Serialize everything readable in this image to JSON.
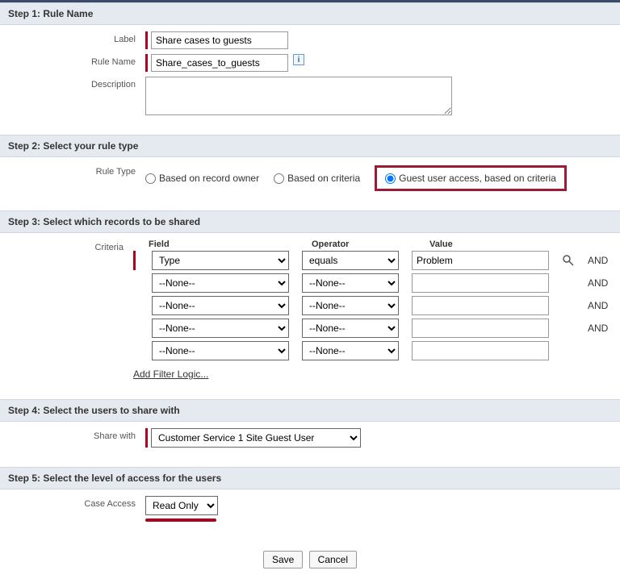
{
  "steps": {
    "s1": {
      "title": "Step 1: Rule Name"
    },
    "s2": {
      "title": "Step 2: Select your rule type"
    },
    "s3": {
      "title": "Step 3: Select which records to be shared"
    },
    "s4": {
      "title": "Step 4: Select the users to share with"
    },
    "s5": {
      "title": "Step 5: Select the level of access for the users"
    }
  },
  "labels": {
    "label": "Label",
    "rule_name": "Rule Name",
    "description": "Description",
    "rule_type": "Rule Type",
    "criteria": "Criteria",
    "share_with": "Share with",
    "case_access": "Case Access",
    "and": "AND",
    "add_filter": "Add Filter Logic..."
  },
  "values": {
    "label": "Share cases to guests",
    "rule_name": "Share_cases_to_guests",
    "description": ""
  },
  "rule_type": {
    "opt1": "Based on record owner",
    "opt2": "Based on criteria",
    "opt3": "Guest user access, based on criteria",
    "selected": "opt3"
  },
  "criteria": {
    "headers": {
      "field": "Field",
      "operator": "Operator",
      "value": "Value"
    },
    "rows": [
      {
        "field": "Type",
        "operator": "equals",
        "value": "Problem",
        "required": true,
        "showAnd": true,
        "showLookup": true
      },
      {
        "field": "--None--",
        "operator": "--None--",
        "value": "",
        "required": false,
        "showAnd": true,
        "showLookup": false
      },
      {
        "field": "--None--",
        "operator": "--None--",
        "value": "",
        "required": false,
        "showAnd": true,
        "showLookup": false
      },
      {
        "field": "--None--",
        "operator": "--None--",
        "value": "",
        "required": false,
        "showAnd": true,
        "showLookup": false
      },
      {
        "field": "--None--",
        "operator": "--None--",
        "value": "",
        "required": false,
        "showAnd": false,
        "showLookup": false
      }
    ]
  },
  "share_with": {
    "value": "Customer Service 1 Site Guest User"
  },
  "case_access": {
    "value": "Read Only"
  },
  "buttons": {
    "save": "Save",
    "cancel": "Cancel"
  },
  "info_glyph": "i"
}
